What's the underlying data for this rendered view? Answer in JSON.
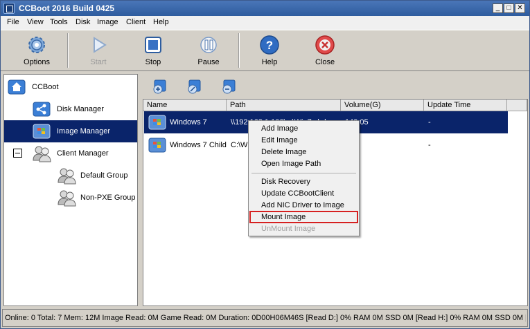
{
  "window": {
    "title": "CCBoot 2016 Build 0425"
  },
  "menubar": [
    "File",
    "View",
    "Tools",
    "Disk",
    "Image",
    "Client",
    "Help"
  ],
  "toolbar": [
    {
      "label": "Options",
      "icon": "gear-icon",
      "enabled": true
    },
    {
      "label": "Start",
      "icon": "play-icon",
      "enabled": false
    },
    {
      "label": "Stop",
      "icon": "stop-icon",
      "enabled": true
    },
    {
      "label": "Pause",
      "icon": "pause-icon",
      "enabled": true
    },
    {
      "label": "Help",
      "icon": "help-icon",
      "enabled": true
    },
    {
      "label": "Close",
      "icon": "close-icon",
      "enabled": true
    }
  ],
  "tree": {
    "root": "CCBoot",
    "items": [
      "Disk Manager",
      "Image Manager",
      "Client Manager",
      "Default Group",
      "Non-PXE Group"
    ],
    "selected": "Image Manager"
  },
  "list": {
    "columns": [
      "Name",
      "Path",
      "Volume(G)",
      "Update Time"
    ],
    "rows": [
      {
        "name": "Windows 7",
        "path": "\\\\192.168.1.100\\...\\Win7.vhd",
        "volume": "149.05",
        "update": "-"
      },
      {
        "name": "Windows 7 Child",
        "path": "C:\\W",
        "volume": "0",
        "update": "-"
      }
    ]
  },
  "context_menu": {
    "items": [
      "Add Image",
      "Edit Image",
      "Delete Image",
      "Open Image Path",
      "Disk Recovery",
      "Update CCBootClient",
      "Add NIC Driver to Image",
      "Mount Image",
      "UnMount Image"
    ],
    "highlighted": "Mount Image",
    "disabled": [
      "UnMount Image"
    ]
  },
  "status": {
    "text": "Online: 0 Total: 7 Mem: 12M Image Read: 0M Game Read: 0M Duration: 0D00H06M46S [Read D:] 0% RAM 0M SSD 0M [Read H:] 0% RAM 0M SSD 0M [W"
  },
  "colors": {
    "selection": "#0a246a",
    "title": "#2e5c9e",
    "highlight_border": "#d62020"
  }
}
